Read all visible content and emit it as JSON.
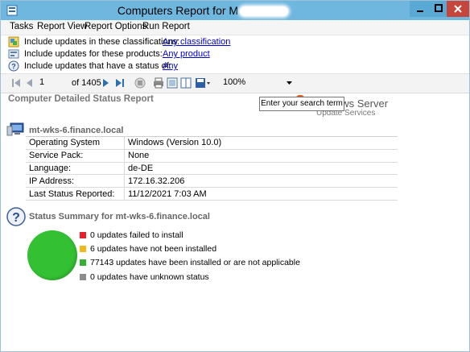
{
  "window": {
    "title": "Computers Report for M",
    "title_redacted": true
  },
  "menu": [
    "Tasks",
    "Report View",
    "Report Options",
    "Run Report"
  ],
  "filters": [
    {
      "label": "Include updates in these classifications:",
      "value": "Any classification"
    },
    {
      "label": "Include updates for these products:",
      "value": "Any product"
    },
    {
      "label": "Include updates that have a status of:",
      "value": "Any"
    }
  ],
  "toolbar": {
    "page": "1",
    "page_of": "of 1405",
    "zoom": "100%"
  },
  "report": {
    "title": "Computer Detailed Status Report",
    "tooltip": "Enter your search term",
    "logo_text": "ows Server",
    "logo_sub": "Update Services",
    "computer_name": "mt-wks-6.finance.local",
    "details": [
      {
        "key": "Operating System",
        "value": "Windows (Version 10.0)"
      },
      {
        "key": "Service Pack:",
        "value": "None"
      },
      {
        "key": "Language:",
        "value": "de-DE"
      },
      {
        "key": "IP Address:",
        "value": "172.16.32.206"
      },
      {
        "key": "Last Status Reported:",
        "value": "11/12/2021 7:03 AM"
      }
    ],
    "summary_heading": "Status Summary for mt-wks-6.finance.local",
    "legend": [
      {
        "text": "0 updates failed to install",
        "color": "#e8202a"
      },
      {
        "text": "6 updates have not been installed",
        "color": "#f2b71b"
      },
      {
        "text": "77143 updates have been installed or are not applicable",
        "color": "#33b133"
      },
      {
        "text": "0 updates have unknown status",
        "color": "#8e8e8e"
      }
    ],
    "pie_color": "#33c133"
  },
  "icons": {
    "app": "report-app-icon",
    "classification": "classification-icon",
    "product": "product-icon",
    "status": "help-icon",
    "computer": "computer-icon",
    "summary": "help-icon"
  }
}
